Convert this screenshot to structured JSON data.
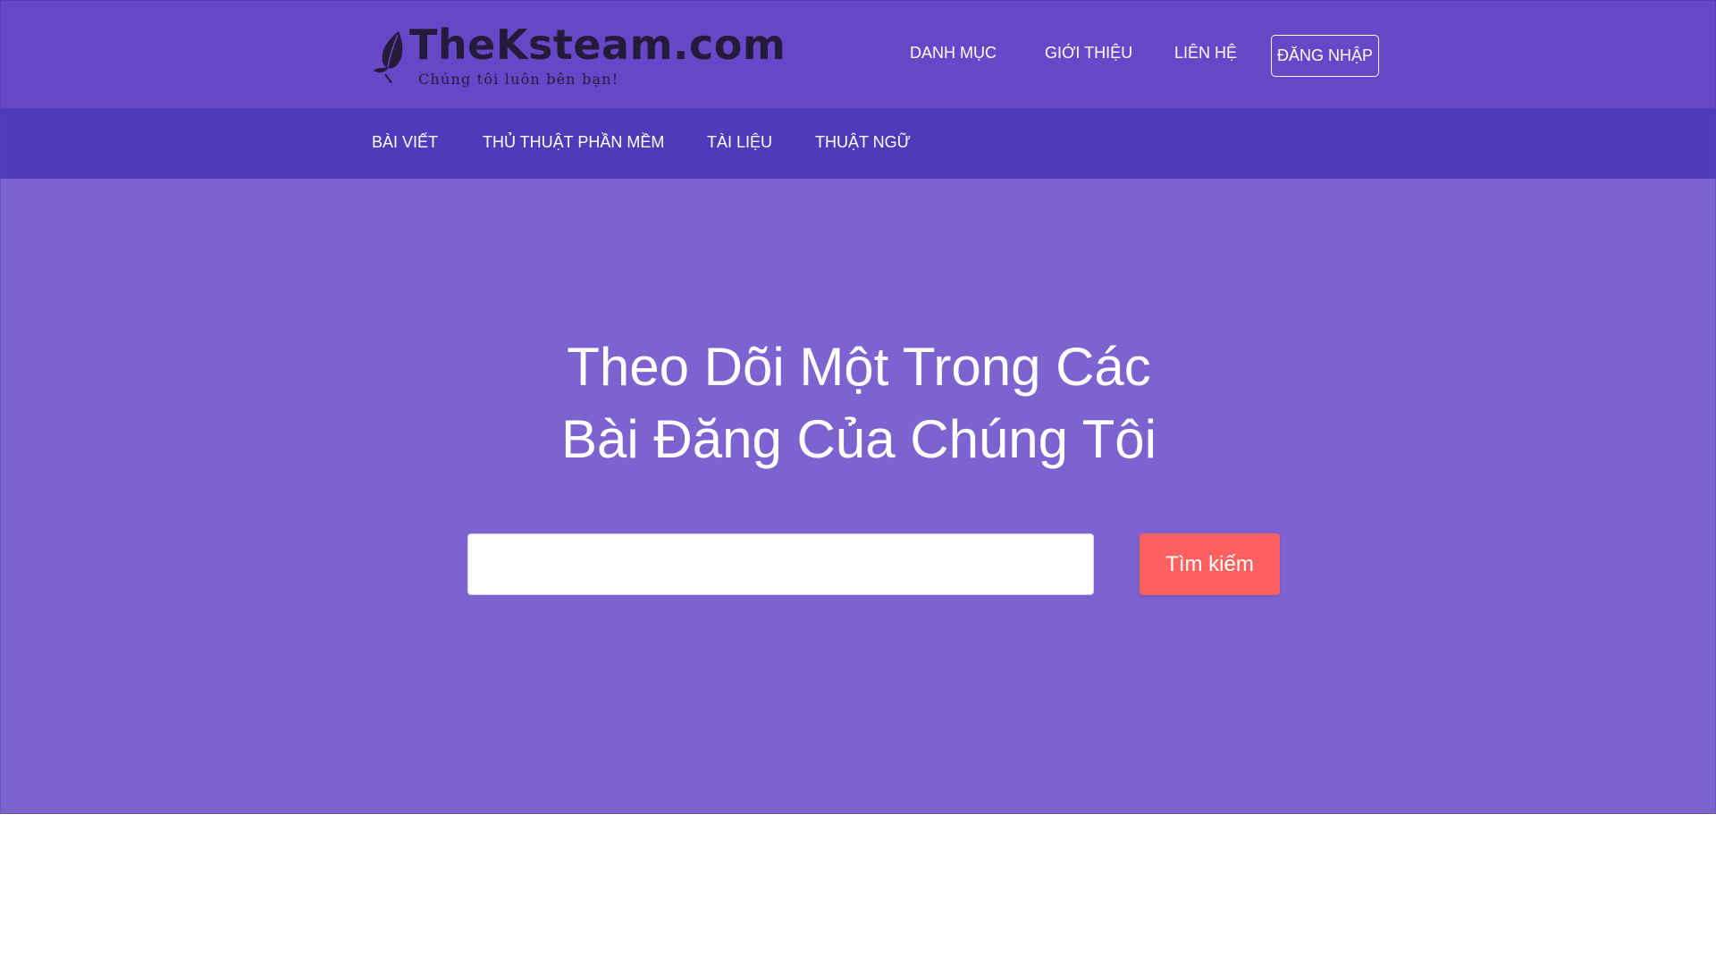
{
  "brand": {
    "name": "TheKsteam.com",
    "tagline": "Chúng tôi luôn bên bạn!",
    "logo_icon": "leaf-icon"
  },
  "header": {
    "nav": [
      {
        "label": "DANH MỤC"
      },
      {
        "label": "GIỚI THIỆU"
      },
      {
        "label": "LIÊN HỆ"
      }
    ],
    "login_label": "ĐĂNG NHẬP"
  },
  "subnav": {
    "items": [
      {
        "label": "BÀI VIẾT"
      },
      {
        "label": "THỦ THUẬT PHẦN MỀM"
      },
      {
        "label": "TÀI LIỆU"
      },
      {
        "label": "THUẬT NGỮ"
      }
    ]
  },
  "hero": {
    "title_line1": "Theo Dõi Một Trong Các",
    "title_line2": "Bài Đăng Của Chúng Tôi",
    "search_value": "",
    "search_button": "Tìm kiếm"
  },
  "colors": {
    "header_bg": "#6747c7",
    "subnav_bg": "#4e3bba",
    "hero_bg": "#7d63cf",
    "button_bg": "#fd6261",
    "logo_text": "#241a3a"
  }
}
